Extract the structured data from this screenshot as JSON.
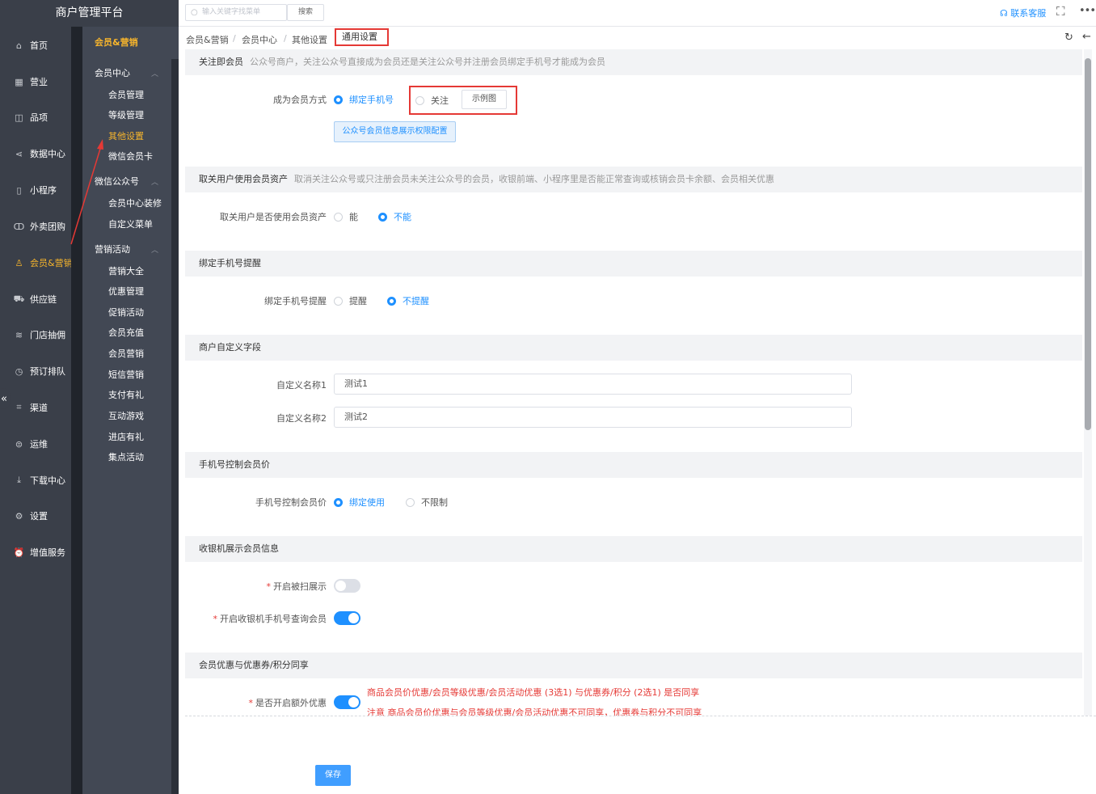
{
  "brand": "商户管理平台",
  "nav1": [
    {
      "label": "首页",
      "icon": "home-icon"
    },
    {
      "label": "营业",
      "icon": "calendar-icon"
    },
    {
      "label": "品项",
      "icon": "bag-icon"
    },
    {
      "label": "数据中心",
      "icon": "share-icon"
    },
    {
      "label": "小程序",
      "icon": "phone-icon"
    },
    {
      "label": "外卖团购",
      "icon": "bike-icon"
    },
    {
      "label": "会员&营销",
      "icon": "user-icon"
    },
    {
      "label": "供应链",
      "icon": "truck-icon"
    },
    {
      "label": "门店抽佣",
      "icon": "database-icon"
    },
    {
      "label": "预订排队",
      "icon": "clock-icon"
    },
    {
      "label": "渠道",
      "icon": "crop-icon"
    },
    {
      "label": "运维",
      "icon": "link-icon"
    },
    {
      "label": "下载中心",
      "icon": "download-icon"
    },
    {
      "label": "设置",
      "icon": "gear-icon"
    },
    {
      "label": "增值服务",
      "icon": "alarm-icon"
    }
  ],
  "nav2": {
    "title": "会员&营销",
    "groups": [
      {
        "label": "会员中心",
        "items": [
          "会员管理",
          "等级管理",
          "其他设置",
          "微信会员卡"
        ]
      },
      {
        "label": "微信公众号",
        "items": [
          "会员中心装修",
          "自定义菜单"
        ]
      },
      {
        "label": "营销活动",
        "items": [
          "营销大全",
          "优惠管理",
          "促销活动",
          "会员充值",
          "会员营销",
          "短信营销",
          "支付有礼",
          "互动游戏",
          "进店有礼",
          "集点活动"
        ]
      }
    ]
  },
  "topbar": {
    "search_placeholder": "输入关键字找菜单",
    "search_button": "搜索",
    "contact": "联系客服"
  },
  "breadcrumb": [
    "会员&营销",
    "会员中心",
    "其他设置",
    "通用设置"
  ],
  "sections": {
    "follow": {
      "title": "关注即会员",
      "desc": "公众号商户，关注公众号直接成为会员还是关注公众号并注册会员绑定手机号才能成为会员",
      "label": "成为会员方式",
      "options": [
        "绑定手机号",
        "关注"
      ],
      "selected": "绑定手机号",
      "demo_button": "示例图",
      "perm_button": "公众号会员信息展示权限配置"
    },
    "unfollow": {
      "title": "取关用户使用会员资产",
      "desc": "取消关注公众号或只注册会员未关注公众号的会员，收银前端、小程序里是否能正常查询或核销会员卡余额、会员相关优惠",
      "label": "取关用户是否使用会员资产",
      "options": [
        "能",
        "不能"
      ],
      "selected": "不能"
    },
    "bindphone": {
      "title": "绑定手机号提醒",
      "label": "绑定手机号提醒",
      "options": [
        "提醒",
        "不提醒"
      ],
      "selected": "不提醒"
    },
    "custom": {
      "title": "商户自定义字段",
      "fields": [
        {
          "label": "自定义名称1",
          "value": "测试1"
        },
        {
          "label": "自定义名称2",
          "value": "测试2"
        }
      ]
    },
    "phoneprice": {
      "title": "手机号控制会员价",
      "label": "手机号控制会员价",
      "options": [
        "绑定使用",
        "不限制"
      ],
      "selected": "绑定使用"
    },
    "cashier": {
      "title": "收银机展示会员信息",
      "toggles": [
        {
          "label": "开启被扫展示",
          "on": false
        },
        {
          "label": "开启收银机手机号查询会员",
          "on": true
        }
      ]
    },
    "share": {
      "title": "会员优惠与优惠券/积分同享",
      "label": "是否开启额外优惠",
      "on": true,
      "note1": "商品会员价优惠/会员等级优惠/会员活动优惠 (3选1) 与优惠券/积分 (2选1) 是否同享",
      "note2": "注意 商品会员价优惠与会员等级优惠/会员活动优惠不可同享，优惠券与积分不可同享"
    }
  },
  "save_button": "保存",
  "colors": {
    "accent": "#1e90ff",
    "highlight": "#e53935",
    "active_nav": "#f7b52c",
    "sidebar": "#3a3f49"
  }
}
